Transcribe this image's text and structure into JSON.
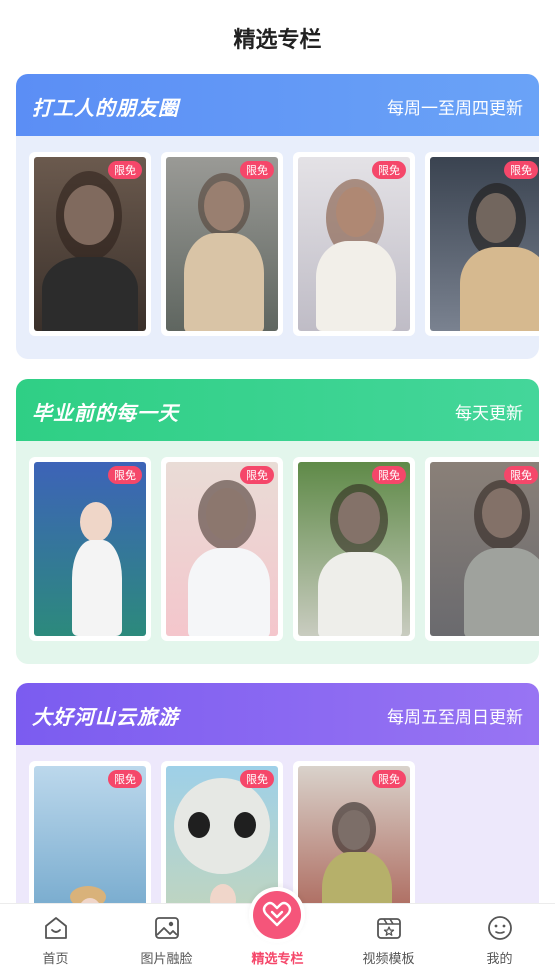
{
  "page": {
    "title": "精选专栏"
  },
  "colors": {
    "accent": "#f5476a",
    "blue": "#5b8ef5",
    "green": "#2fcf85",
    "purple": "#7b5cf0"
  },
  "sections": [
    {
      "title": "打工人的朋友圈",
      "schedule": "每周一至周四更新",
      "cards": [
        {
          "badge": "限免"
        },
        {
          "badge": "限免"
        },
        {
          "badge": "限免"
        },
        {
          "badge": "限免"
        }
      ]
    },
    {
      "title": "毕业前的每一天",
      "schedule": "每天更新",
      "cards": [
        {
          "badge": "限免"
        },
        {
          "badge": "限免"
        },
        {
          "badge": "限免"
        },
        {
          "badge": "限免"
        }
      ]
    },
    {
      "title": "大好河山云旅游",
      "schedule": "每周五至周日更新",
      "cards": [
        {
          "badge": "限免"
        },
        {
          "badge": "限免"
        },
        {
          "badge": "限免"
        }
      ]
    }
  ],
  "nav": [
    {
      "label": "首页",
      "icon": "home-smile-icon"
    },
    {
      "label": "图片融脸",
      "icon": "image-icon"
    },
    {
      "label": "精选专栏",
      "icon": "heart-chevron-icon",
      "active": true
    },
    {
      "label": "视频模板",
      "icon": "video-star-icon"
    },
    {
      "label": "我的",
      "icon": "face-icon"
    }
  ]
}
